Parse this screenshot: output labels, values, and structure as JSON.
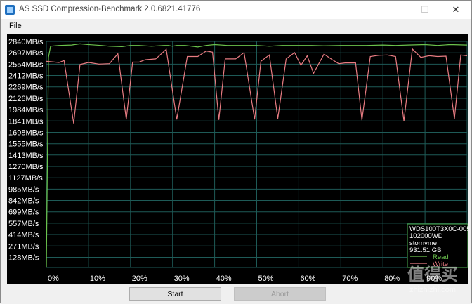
{
  "window": {
    "title": "AS SSD Compression-Benchmark 2.0.6821.41776",
    "minimize_glyph": "—",
    "maximize_glyph": "☐",
    "close_glyph": "✕"
  },
  "menu": {
    "file": "File"
  },
  "buttons": {
    "start": "Start",
    "abort": "Abort"
  },
  "legend": {
    "device_model": "WDS100T3X0C-005",
    "firmware": "102000WD",
    "driver": "stornvme",
    "capacity": "931.51 GB",
    "read_label": "Read",
    "write_label": "Write"
  },
  "watermark": {
    "glyphs": "值得买",
    "site": "zhizhizhi.com"
  },
  "colors": {
    "read": "#6cc44e",
    "write": "#e87c82",
    "grid": "#1e5a57",
    "axis_text": "#ffffff",
    "legend_border": "#4caf50"
  },
  "chart_data": {
    "type": "line",
    "ylim": [
      0,
      2840
    ],
    "y_ticks": [
      "2840MB/s",
      "2697MB/s",
      "2554MB/s",
      "2412MB/s",
      "2269MB/s",
      "2126MB/s",
      "1984MB/s",
      "1841MB/s",
      "1698MB/s",
      "1555MB/s",
      "1413MB/s",
      "1270MB/s",
      "1127MB/s",
      "985MB/s",
      "842MB/s",
      "699MB/s",
      "557MB/s",
      "414MB/s",
      "271MB/s",
      "128MB/s"
    ],
    "y_tick_values": [
      2840,
      2697,
      2554,
      2412,
      2269,
      2126,
      1984,
      1841,
      1698,
      1555,
      1413,
      1270,
      1127,
      985,
      842,
      699,
      557,
      414,
      271,
      128
    ],
    "x_ticks": [
      "0%",
      "10%",
      "20%",
      "30%",
      "40%",
      "50%",
      "60%",
      "70%",
      "80%",
      "90%",
      "100%"
    ],
    "x_tick_values": [
      0,
      10,
      20,
      30,
      40,
      50,
      60,
      70,
      80,
      90,
      100
    ],
    "xlim": [
      0,
      100
    ],
    "series": [
      {
        "name": "Read",
        "points": [
          [
            0,
            0
          ],
          [
            0.5,
            2640
          ],
          [
            1,
            2780
          ],
          [
            3,
            2790
          ],
          [
            6,
            2795
          ],
          [
            8,
            2810
          ],
          [
            10,
            2800
          ],
          [
            13,
            2790
          ],
          [
            15,
            2780
          ],
          [
            18,
            2775
          ],
          [
            20,
            2790
          ],
          [
            22,
            2790
          ],
          [
            25,
            2780
          ],
          [
            28,
            2790
          ],
          [
            29,
            2790
          ],
          [
            30,
            2780
          ],
          [
            31,
            2790
          ],
          [
            33,
            2790
          ],
          [
            36,
            2770
          ],
          [
            38,
            2790
          ],
          [
            40,
            2800
          ],
          [
            43,
            2790
          ],
          [
            46,
            2790
          ],
          [
            50,
            2790
          ],
          [
            53,
            2780
          ],
          [
            56,
            2790
          ],
          [
            60,
            2790
          ],
          [
            63,
            2790
          ],
          [
            66,
            2785
          ],
          [
            70,
            2790
          ],
          [
            73,
            2790
          ],
          [
            76,
            2790
          ],
          [
            80,
            2795
          ],
          [
            83,
            2790
          ],
          [
            86,
            2795
          ],
          [
            90,
            2800
          ],
          [
            93,
            2790
          ],
          [
            96,
            2800
          ],
          [
            100,
            2795
          ]
        ]
      },
      {
        "name": "Write",
        "points": [
          [
            0,
            2590
          ],
          [
            3,
            2575
          ],
          [
            4.2,
            2600
          ],
          [
            6.5,
            1810
          ],
          [
            8,
            2550
          ],
          [
            10,
            2575
          ],
          [
            12.5,
            2555
          ],
          [
            15,
            2560
          ],
          [
            17,
            2685
          ],
          [
            19,
            1860
          ],
          [
            20.5,
            2580
          ],
          [
            22,
            2580
          ],
          [
            23.5,
            2610
          ],
          [
            26,
            2620
          ],
          [
            28.5,
            2740
          ],
          [
            31,
            1860
          ],
          [
            33.5,
            2650
          ],
          [
            36,
            2650
          ],
          [
            38,
            2720
          ],
          [
            39.5,
            2705
          ],
          [
            41,
            1855
          ],
          [
            42.5,
            2620
          ],
          [
            45,
            2620
          ],
          [
            47,
            2700
          ],
          [
            49.5,
            1860
          ],
          [
            51,
            2590
          ],
          [
            53,
            2670
          ],
          [
            55,
            1870
          ],
          [
            57,
            2620
          ],
          [
            59,
            2700
          ],
          [
            60.5,
            2540
          ],
          [
            62,
            2660
          ],
          [
            63.5,
            2440
          ],
          [
            66,
            2680
          ],
          [
            68,
            2610
          ],
          [
            69.5,
            2560
          ],
          [
            71,
            2570
          ],
          [
            73.5,
            2570
          ],
          [
            75,
            1850
          ],
          [
            77,
            2650
          ],
          [
            79,
            2665
          ],
          [
            81,
            2670
          ],
          [
            83,
            2650
          ],
          [
            85,
            1840
          ],
          [
            87,
            2745
          ],
          [
            89,
            2640
          ],
          [
            91,
            2660
          ],
          [
            93,
            2650
          ],
          [
            95,
            2655
          ],
          [
            97,
            1870
          ],
          [
            98.5,
            2670
          ],
          [
            100,
            2660
          ]
        ]
      }
    ]
  }
}
